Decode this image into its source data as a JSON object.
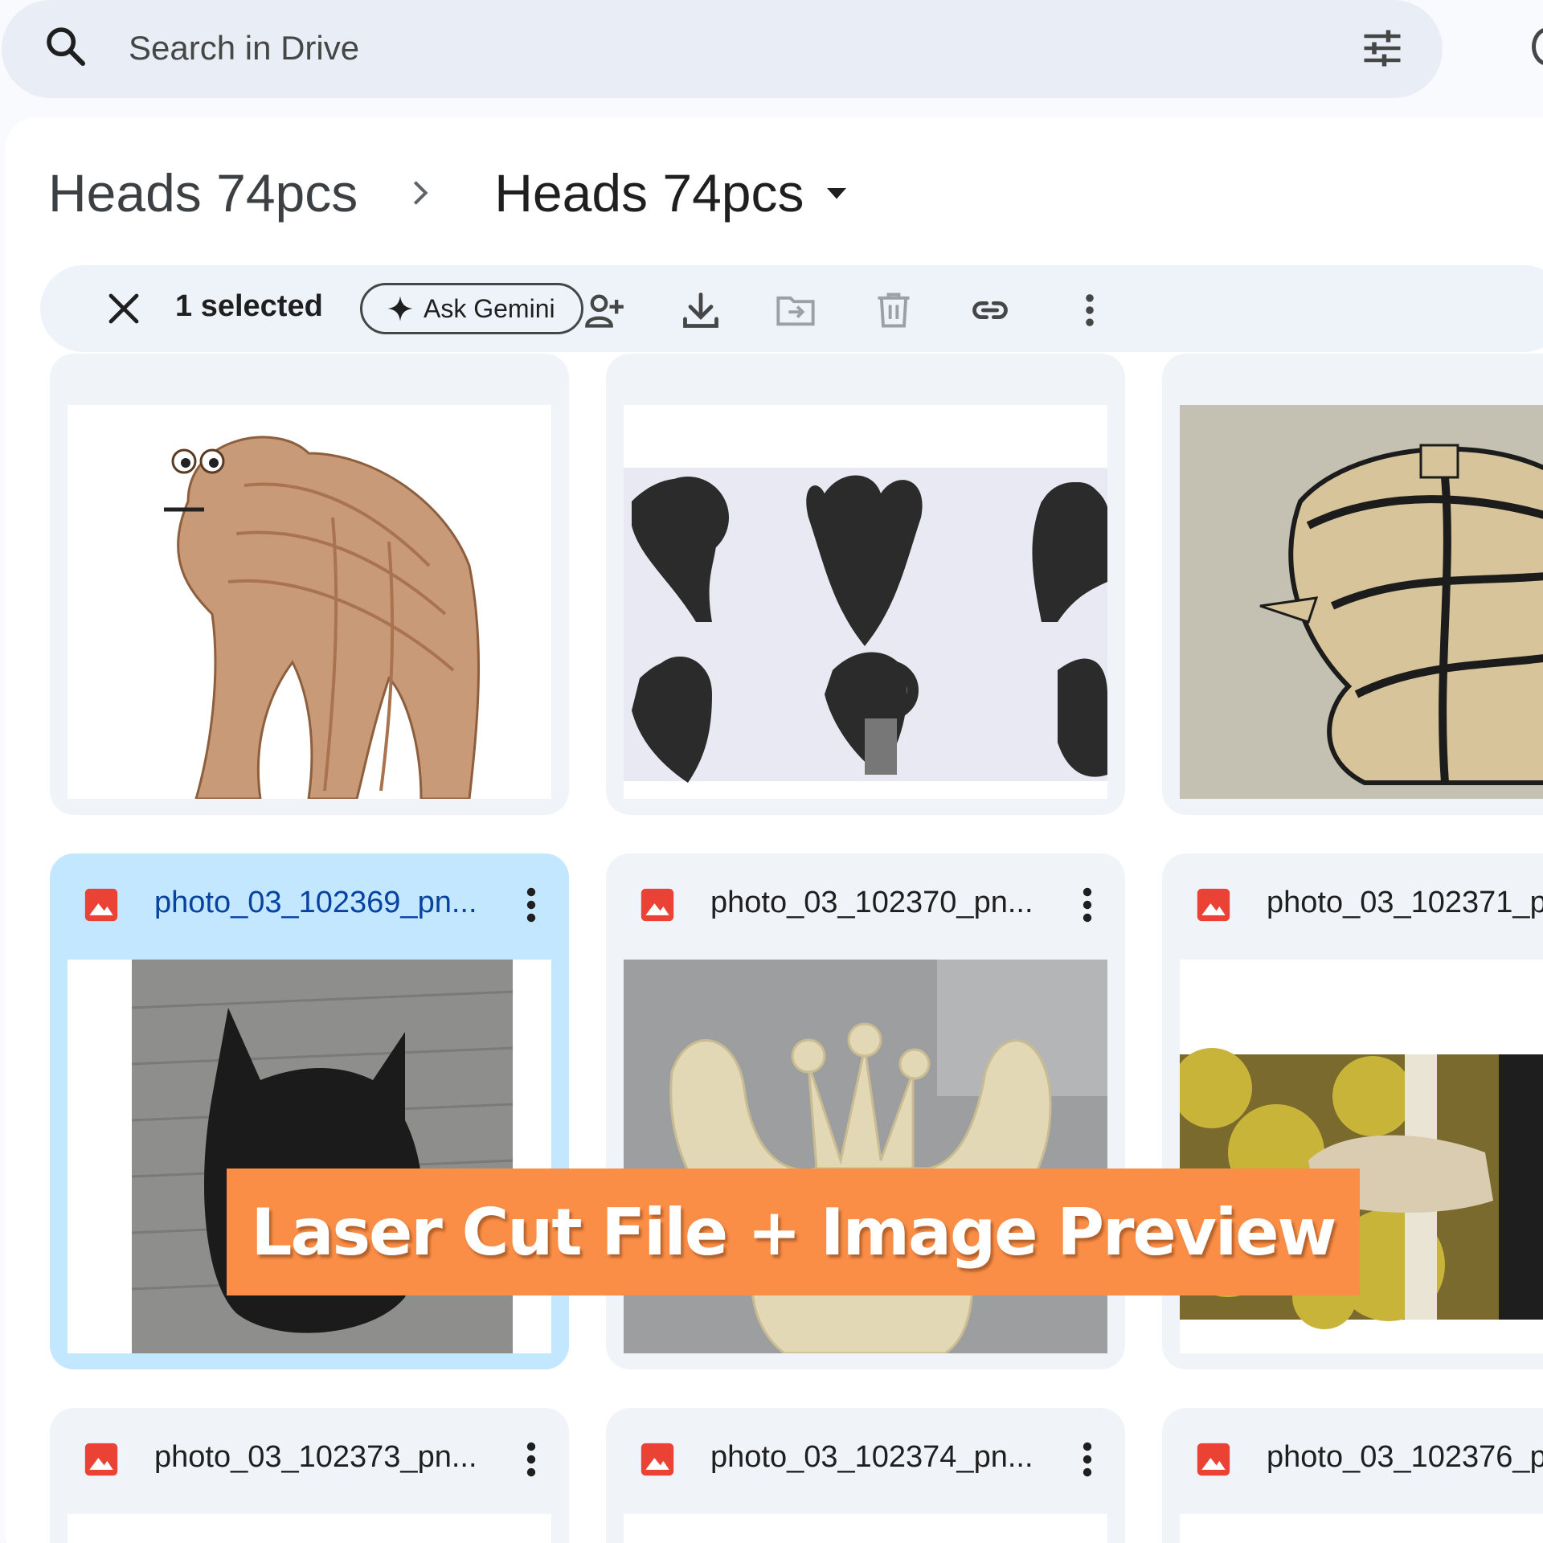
{
  "search": {
    "placeholder": "Search in Drive"
  },
  "breadcrumb": {
    "parent": "Heads 74pcs",
    "current": "Heads 74pcs"
  },
  "toolbar": {
    "selected_text": "1 selected",
    "gemini_label": "Ask Gemini"
  },
  "files": [
    {
      "name": "photo_03_102369_pn...",
      "selected": true
    },
    {
      "name": "photo_03_102370_pn...",
      "selected": false
    },
    {
      "name": "photo_03_102371_p",
      "selected": false
    },
    {
      "name": "photo_03_102373_pn...",
      "selected": false
    },
    {
      "name": "photo_03_102374_pn...",
      "selected": false
    },
    {
      "name": "photo_03_102376_p",
      "selected": false
    }
  ],
  "banner": {
    "text": "Laser Cut File + Image Preview"
  },
  "colors": {
    "accent": "#fa8e47",
    "selected_card": "#c2e7ff",
    "image_icon": "#ea4335"
  }
}
